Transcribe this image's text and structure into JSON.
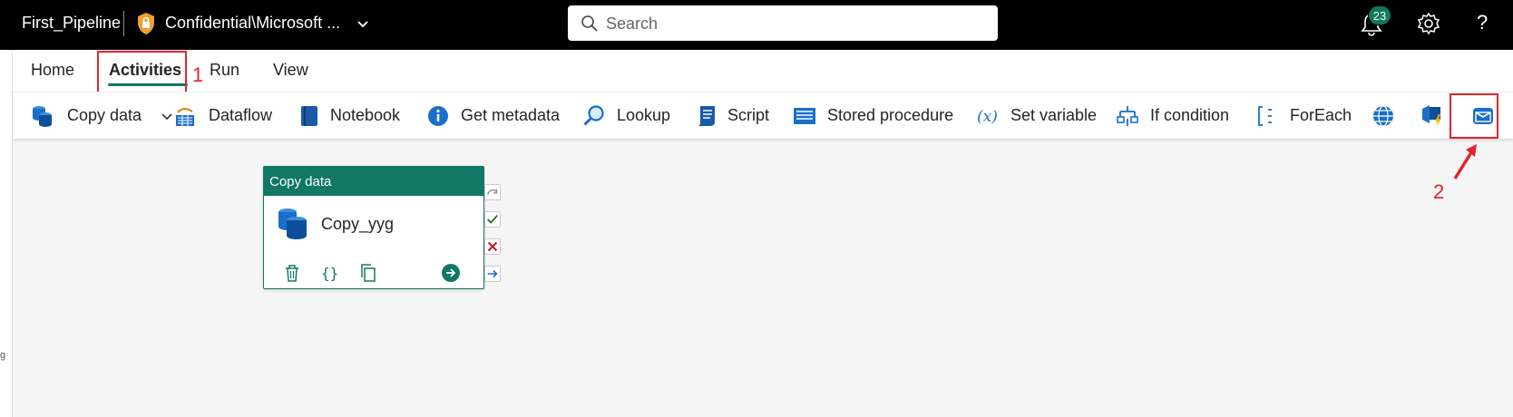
{
  "topbar": {
    "title": "First_Pipeline",
    "sensitivity": "Confidential\\Microsoft ...",
    "search_placeholder": "Search",
    "notification_count": "23",
    "help_label": "?"
  },
  "tabs": [
    {
      "label": "Home"
    },
    {
      "label": "Activities"
    },
    {
      "label": "Run"
    },
    {
      "label": "View"
    }
  ],
  "ribbon": {
    "items": [
      {
        "label": "Copy data",
        "icon": "copy-data-icon"
      },
      {
        "label": "Dataflow",
        "icon": "dataflow-icon"
      },
      {
        "label": "Notebook",
        "icon": "notebook-icon"
      },
      {
        "label": "Get metadata",
        "icon": "info-icon"
      },
      {
        "label": "Lookup",
        "icon": "lookup-icon"
      },
      {
        "label": "Script",
        "icon": "script-icon"
      },
      {
        "label": "Stored procedure",
        "icon": "stored-procedure-icon"
      },
      {
        "label": "Set variable",
        "icon": "variable-icon"
      },
      {
        "label": "If condition",
        "icon": "if-condition-icon"
      },
      {
        "label": "ForEach",
        "icon": "foreach-icon"
      }
    ],
    "extra_icons": [
      "globe-icon",
      "azure-function-icon",
      "outlook-mail-icon"
    ]
  },
  "annotations": {
    "one": "1",
    "two": "2"
  },
  "canvas": {
    "card": {
      "header": "Copy data",
      "name": "Copy_yyg"
    }
  },
  "left_glyph": "g",
  "colors": {
    "accent": "#117865",
    "annotation": "#e3242b",
    "topbar": "#000000",
    "icon_blue": "#1a6fc9"
  }
}
